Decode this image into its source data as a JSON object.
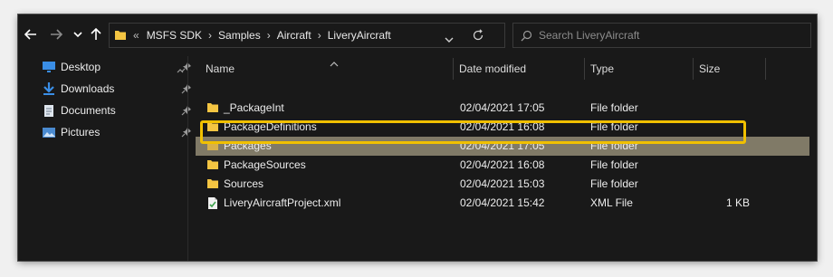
{
  "breadcrumb": {
    "overflow": "«",
    "segments": [
      "MSFS SDK",
      "Samples",
      "Aircraft",
      "LiveryAircraft"
    ]
  },
  "search": {
    "placeholder": "Search LiveryAircraft"
  },
  "nav_icons": [
    "back-arrow-icon",
    "forward-arrow-icon",
    "recent-locations-chevron-icon",
    "up-arrow-icon",
    "refresh-icon",
    "search-icon"
  ],
  "sidebar": {
    "items": [
      {
        "label": "Desktop",
        "icon": "desktop-icon",
        "pinned": true
      },
      {
        "label": "Downloads",
        "icon": "download-icon",
        "pinned": true
      },
      {
        "label": "Documents",
        "icon": "document-icon",
        "pinned": true
      },
      {
        "label": "Pictures",
        "icon": "pictures-icon",
        "pinned": true
      }
    ]
  },
  "columns": {
    "name": "Name",
    "date": "Date modified",
    "type": "Type",
    "size": "Size"
  },
  "files": [
    {
      "name": "_PackageInt",
      "date": "02/04/2021 17:05",
      "type": "File folder",
      "size": "",
      "icon": "folder-icon"
    },
    {
      "name": "PackageDefinitions",
      "date": "02/04/2021 16:08",
      "type": "File folder",
      "size": "",
      "icon": "folder-icon"
    },
    {
      "name": "Packages",
      "date": "02/04/2021 17:05",
      "type": "File folder",
      "size": "",
      "icon": "folder-icon",
      "selected": true
    },
    {
      "name": "PackageSources",
      "date": "02/04/2021 16:08",
      "type": "File folder",
      "size": "",
      "icon": "folder-icon"
    },
    {
      "name": "Sources",
      "date": "02/04/2021 15:03",
      "type": "File folder",
      "size": "",
      "icon": "folder-icon"
    },
    {
      "name": "LiveryAircraftProject.xml",
      "date": "02/04/2021 15:42",
      "type": "XML File",
      "size": "1 KB",
      "icon": "xml-file-icon"
    }
  ],
  "colors": {
    "window_bg": "#191919",
    "selection": "#807a67",
    "highlight_outline": "#f0c000",
    "folder": "#f4c542"
  }
}
